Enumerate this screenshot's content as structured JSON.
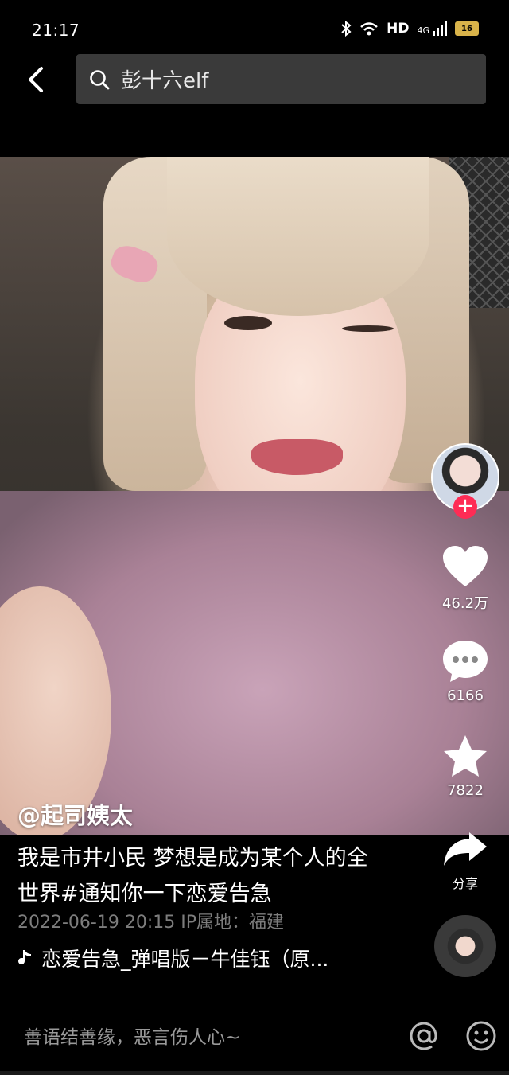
{
  "status_bar": {
    "time": "21:17",
    "network": "HD",
    "signal": "4G",
    "battery": "16"
  },
  "search": {
    "query": "彭十六elf"
  },
  "video": {
    "author": "@起司姨太",
    "description": "我是市井小民 梦想是成为某个人的全世界#通知你一下恋爱告急",
    "meta": "2022-06-19 20:15  IP属地：福建",
    "music": "恋爱告急_弹唱版－牛佳钰（原..."
  },
  "actions": {
    "likes": "46.2万",
    "comments": "6166",
    "favorites": "7822",
    "share": "分享"
  },
  "comment_bar": {
    "placeholder": "善语结善缘，恶言伤人心~"
  },
  "colors": {
    "accent": "#fe2c55",
    "background": "#000000",
    "search_bg": "#3a3a3a"
  }
}
